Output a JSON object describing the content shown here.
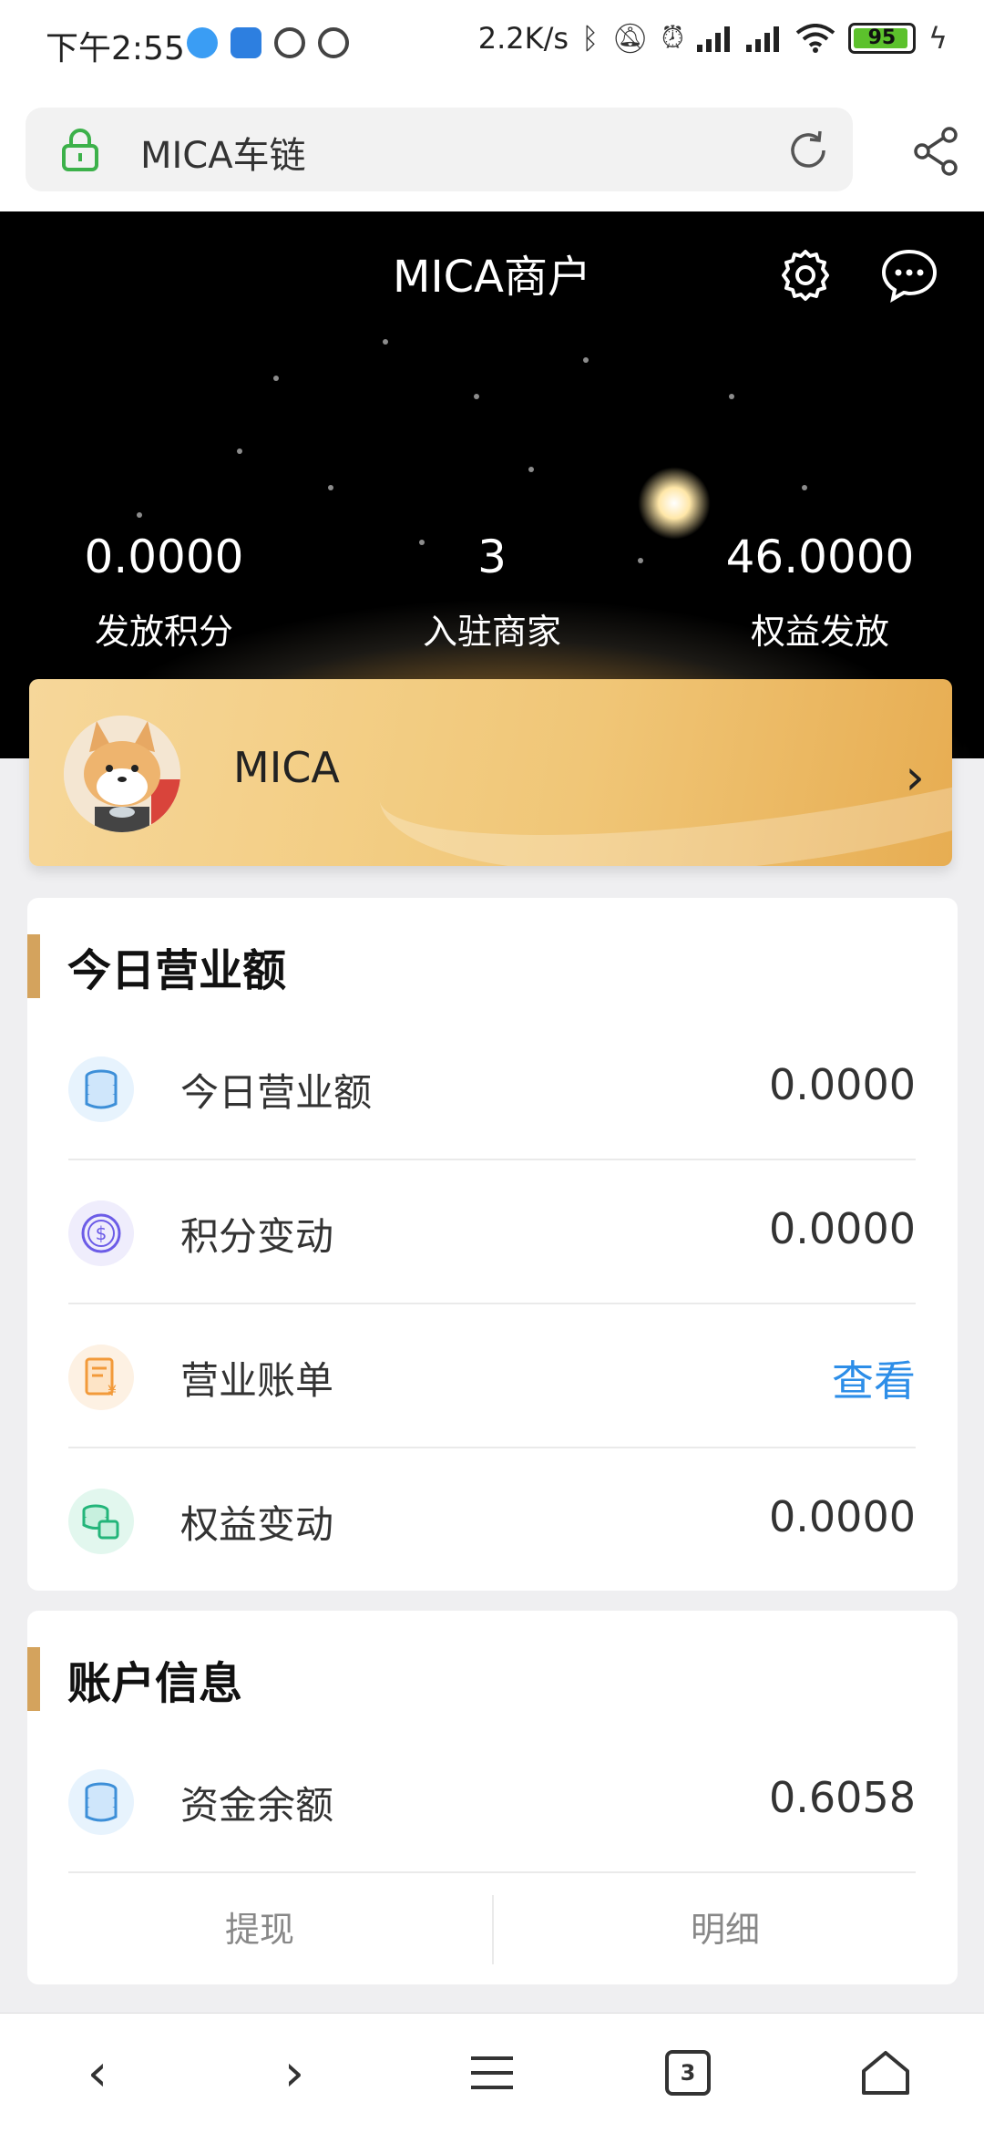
{
  "status_bar": {
    "time": "下午2:55",
    "network_speed": "2.2K/s",
    "battery": "95",
    "battery_level": 0.95
  },
  "browser": {
    "page_title": "MICA车链",
    "icons": [
      "lock-icon",
      "reload-icon",
      "share-icon"
    ]
  },
  "header": {
    "title": "MICA商户",
    "icons": [
      "gear-icon",
      "chat-icon"
    ]
  },
  "stats": [
    {
      "value": "0.0000",
      "label": "发放积分"
    },
    {
      "value": "3",
      "label": "入驻商家"
    },
    {
      "value": "46.0000",
      "label": "权益发放"
    }
  ],
  "merchant": {
    "name": "MICA"
  },
  "today_card": {
    "title": "今日营业额",
    "rows": [
      {
        "label": "今日营业额",
        "value": "0.0000",
        "icon": "coin-stack-icon"
      },
      {
        "label": "积分变动",
        "value": "0.0000",
        "icon": "dollar-circle-icon"
      },
      {
        "label": "营业账单",
        "value": "查看",
        "icon": "bill-icon"
      },
      {
        "label": "权益变动",
        "value": "0.0000",
        "icon": "coins-icon"
      }
    ]
  },
  "account_card": {
    "title": "账户信息",
    "rows": [
      {
        "label": "资金余额",
        "value": "0.6058",
        "icon": "coin-stack-icon"
      }
    ],
    "actions": [
      "提现",
      "明细"
    ]
  },
  "nav": {
    "tab_count": "3"
  },
  "colors": {
    "accent_gold": "#d4a35d",
    "link_blue": "#2d8ee8"
  }
}
